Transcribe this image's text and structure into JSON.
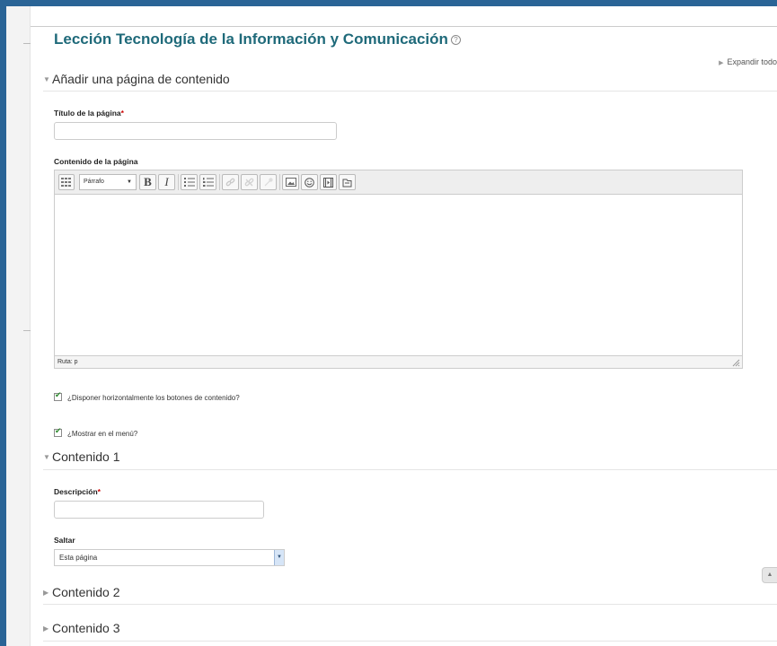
{
  "page": {
    "title": "Lección Tecnología de la Información y Comunicación",
    "help_icon": "question-circle-icon",
    "expand_all_label": "Expandir todo"
  },
  "sections": {
    "add_page": "Añadir una página de contenido",
    "content1": "Contenido 1",
    "content2": "Contenido 2",
    "content3": "Contenido 3"
  },
  "form": {
    "page_title_label": "Título de la página",
    "page_title_value": "",
    "page_content_label": "Contenido de la página",
    "required_mark": "*",
    "editor": {
      "format_value": "Párrafo",
      "status_path": "Ruta: p",
      "content": "",
      "toolbar_icons": [
        "toolbar-toggle-icon",
        "bold-icon",
        "italic-icon",
        "unordered-list-icon",
        "ordered-list-icon",
        "link-icon",
        "unlink-icon",
        "anchor-icon",
        "image-icon",
        "emoticon-icon",
        "media-icon",
        "manage-files-icon"
      ],
      "bold_glyph": "B",
      "italic_glyph": "I"
    },
    "horizontal_buttons": {
      "label": "¿Disponer horizontalmente los botones de contenido?",
      "checked": true
    },
    "show_in_menu": {
      "label": "¿Mostrar en el menú?",
      "checked": true
    },
    "description_label": "Descripción",
    "description_value": "",
    "jump_label": "Saltar",
    "jump_value": "Esta página"
  },
  "colors": {
    "frame": "#2a6496",
    "title": "#1f6a7a",
    "required": "#cc0000",
    "check": "#2f8a2f"
  }
}
